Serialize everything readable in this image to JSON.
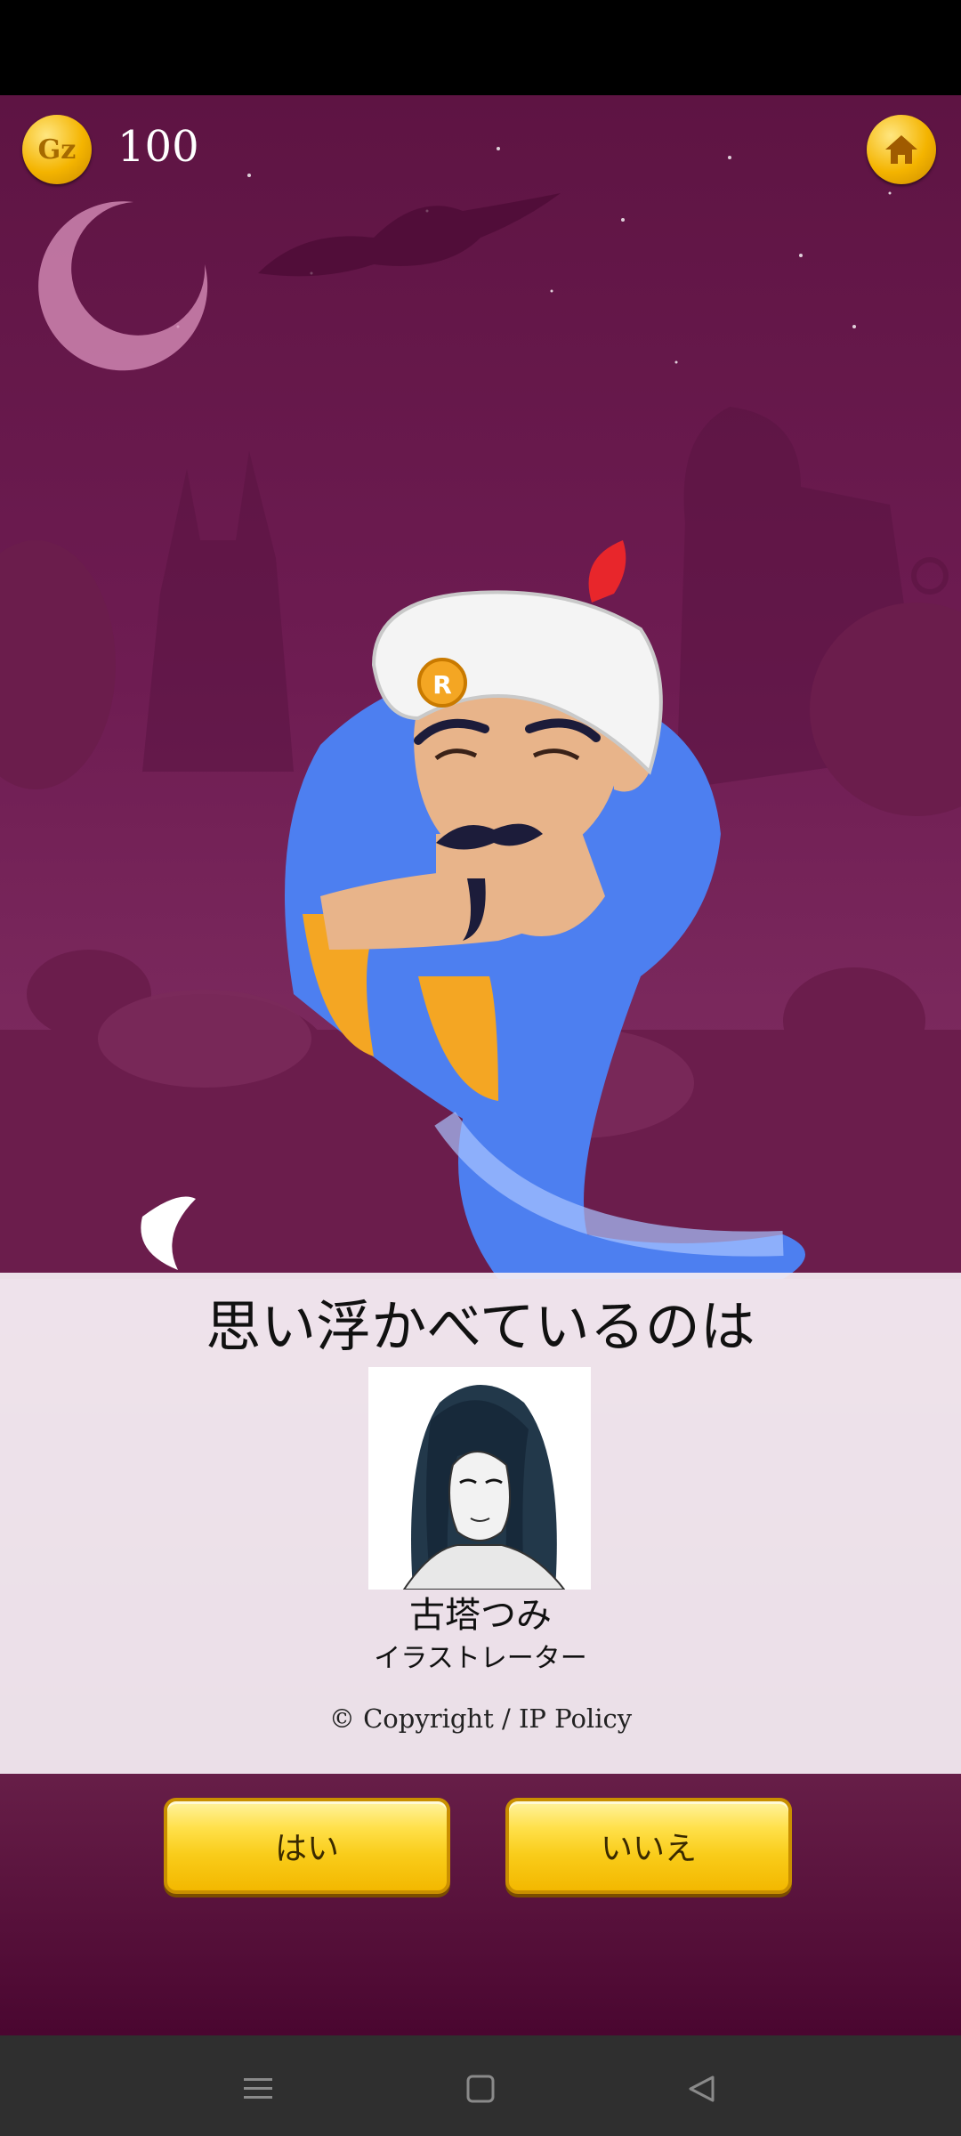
{
  "hud": {
    "coin_label": "Gz",
    "coin_count": "100",
    "home_icon": "home-icon"
  },
  "result": {
    "title": "思い浮かべているのは",
    "character_name": "古塔つみ",
    "character_description": "イラストレーター",
    "copyright": "© Copyright / IP Policy"
  },
  "buttons": {
    "yes_label": "はい",
    "no_label": "いいえ"
  },
  "nav": {
    "menu_icon": "menu-icon",
    "home_icon": "square-home-icon",
    "back_icon": "back-triangle-icon"
  },
  "colors": {
    "background": "#6e1c52",
    "gold": "#f9cc1a",
    "panel": "#f3ecf2"
  }
}
